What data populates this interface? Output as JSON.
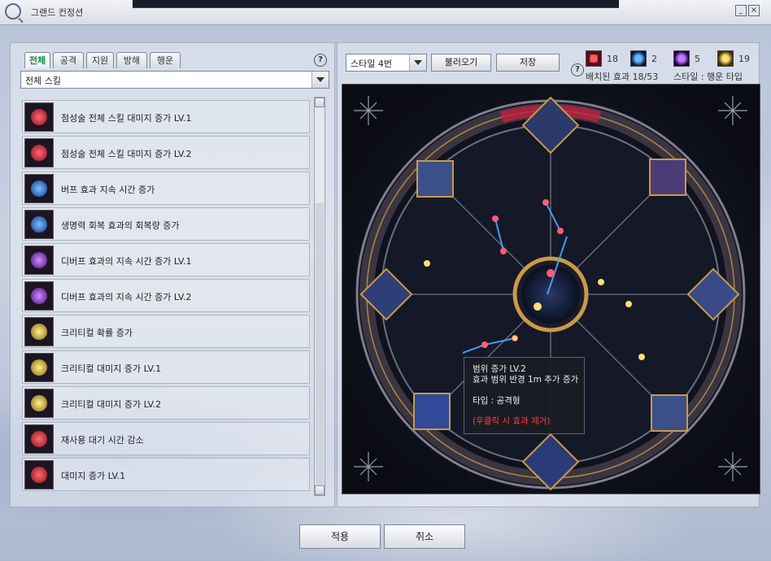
{
  "window": {
    "title": "그랜드 컨정션",
    "minimize": "_",
    "close": "×"
  },
  "tabs": [
    {
      "label": "전체",
      "active": true
    },
    {
      "label": "공격",
      "active": false
    },
    {
      "label": "지원",
      "active": false
    },
    {
      "label": "방해",
      "active": false
    },
    {
      "label": "행운",
      "active": false
    }
  ],
  "help": "?",
  "skill_filter": {
    "selected": "전체 스킬"
  },
  "skills": [
    {
      "label": "점성술 전체 스킬 대미지 증가 LV.1",
      "color": "#e0303c"
    },
    {
      "label": "점성술 전체 스킬 대미지 증가 LV.2",
      "color": "#e0303c"
    },
    {
      "label": "버프 효과 지속 시간 증가",
      "color": "#2a7be0"
    },
    {
      "label": "생명력 회복 효과의 회복량 증가",
      "color": "#2a7be0"
    },
    {
      "label": "디버프 효과의 지속 시간 증가 LV.1",
      "color": "#9a38e0"
    },
    {
      "label": "디버프 효과의 지속 시간 증가 LV.2",
      "color": "#9a38e0"
    },
    {
      "label": "크리티컬 확률 증가",
      "color": "#e0b020"
    },
    {
      "label": "크리티컬 대미지 증가 LV.1",
      "color": "#e0b020"
    },
    {
      "label": "크리티컬 대미지 증가 LV.2",
      "color": "#e0b020"
    },
    {
      "label": "재사용 대기 시간 감소",
      "color": "#e0303c"
    },
    {
      "label": "대미지 증가 LV.1",
      "color": "#e0303c"
    }
  ],
  "style_select": {
    "selected": "스타일 4번"
  },
  "buttons": {
    "load": "불러오기",
    "save": "저장",
    "apply": "적용",
    "cancel": "취소"
  },
  "stats": [
    {
      "value": "18",
      "color": "#e0303c",
      "icon": "attack-constellation-icon"
    },
    {
      "value": "2",
      "color": "#2a7be0",
      "icon": "support-constellation-icon"
    },
    {
      "value": "5",
      "color": "#9a38e0",
      "icon": "hinder-constellation-icon"
    },
    {
      "value": "19",
      "color": "#e0b020",
      "icon": "luck-constellation-icon"
    }
  ],
  "placed_effects": "배치된 효과 18/53",
  "style_type": "스타일 : 행운 타입",
  "tooltip": {
    "line1": "범위 증가 LV.2",
    "line2": "효과 범위 반경 1m 추가 증가",
    "type": "타입 : 공격형",
    "note": "(우클릭 시 효과 제거)"
  }
}
